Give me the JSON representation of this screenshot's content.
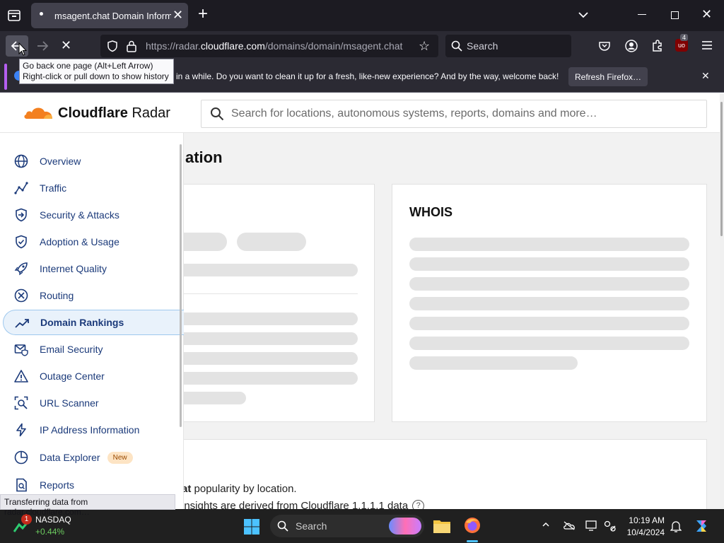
{
  "browser": {
    "tab_title": "msagent.chat Domain Informa",
    "url_prefix": "https://radar.",
    "url_host": "cloudflare.com",
    "url_path": "/domains/domain/msagent.chat",
    "search_placeholder": "Search",
    "extension_badge": "4",
    "tooltip_line1": "Go back one page (Alt+Left Arrow)",
    "tooltip_line2": "Right-click or pull down to show history",
    "notification_text": "in a while. Do you want to clean it up for a fresh, like-new experience? And by the way, welcome back!",
    "refresh_button": "Refresh Firefox…",
    "status_text": "Transferring data from radar.cloudflare.com…"
  },
  "site": {
    "brand_name": "Cloudflare",
    "brand_suffix": "Radar",
    "search_placeholder": "Search for locations, autonomous systems, reports, domains and more…",
    "page_title_fragment": "ation",
    "whois_title": "WHOIS",
    "popularity_bold": "at",
    "popularity_text": "popularity by location.",
    "insights_text": "insights are derived from Cloudflare 1.1.1.1 data"
  },
  "sidebar": {
    "items": [
      {
        "label": "Overview",
        "icon": "globe-icon"
      },
      {
        "label": "Traffic",
        "icon": "traffic-icon"
      },
      {
        "label": "Security & Attacks",
        "icon": "shield-arrow-icon"
      },
      {
        "label": "Adoption & Usage",
        "icon": "shield-check-icon"
      },
      {
        "label": "Internet Quality",
        "icon": "rocket-icon"
      },
      {
        "label": "Routing",
        "icon": "routing-icon"
      },
      {
        "label": "Domain Rankings",
        "icon": "trending-icon"
      },
      {
        "label": "Email Security",
        "icon": "email-shield-icon"
      },
      {
        "label": "Outage Center",
        "icon": "warning-icon"
      },
      {
        "label": "URL Scanner",
        "icon": "scanner-icon"
      },
      {
        "label": "IP Address Information",
        "icon": "bolt-icon"
      },
      {
        "label": "Data Explorer",
        "icon": "pie-chart-icon"
      },
      {
        "label": "Reports",
        "icon": "report-icon"
      }
    ],
    "active_item": "Domain Rankings",
    "new_badge": "New"
  },
  "taskbar": {
    "stock_name": "NASDAQ",
    "stock_change": "+0.44%",
    "stock_badge": "1",
    "search_placeholder": "Search",
    "time": "10:19 AM",
    "date": "10/4/2024"
  },
  "colors": {
    "accent": "#1b3a7a",
    "cloudflare_orange": "#f38020",
    "active_bg": "#e9f2fb"
  }
}
